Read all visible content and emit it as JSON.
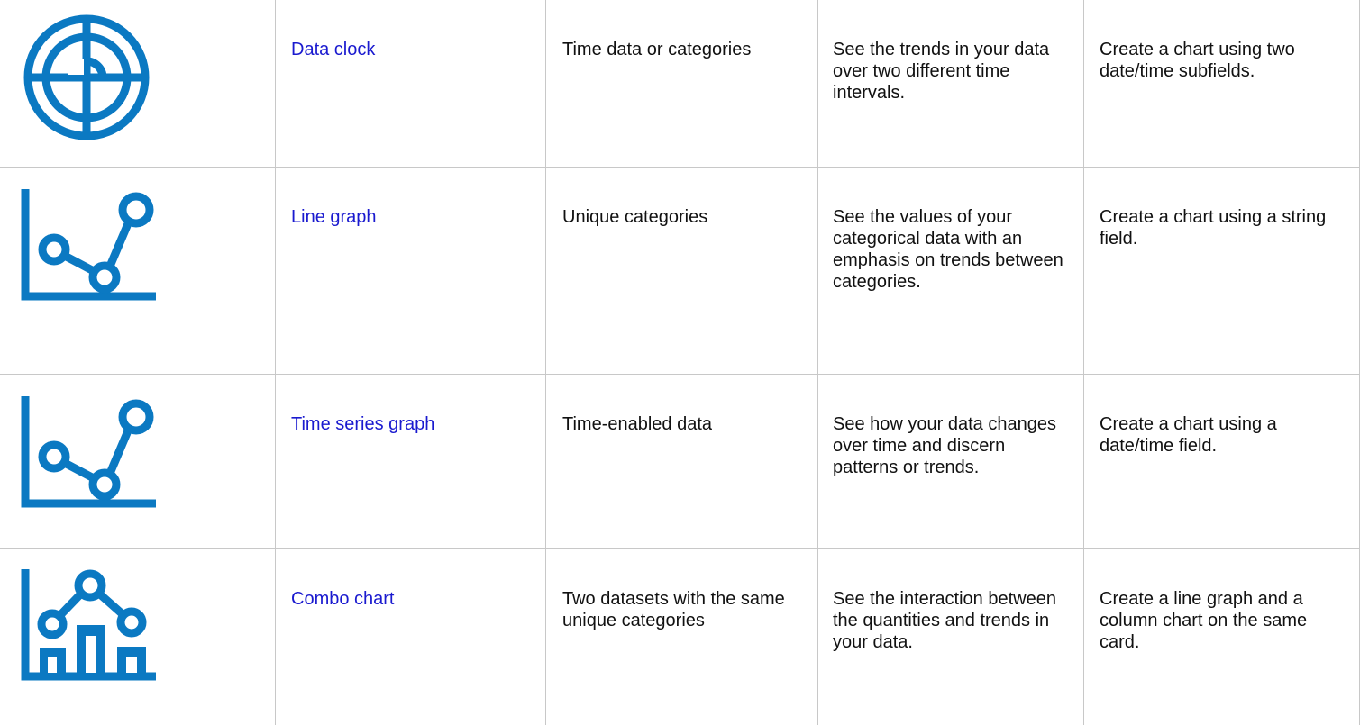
{
  "rows": [
    {
      "icon": "data-clock-icon",
      "name": "Data clock",
      "input": "Time data or categories",
      "purpose": "See the trends in your data over two different time intervals.",
      "create": "Create a chart using two date/time subfields."
    },
    {
      "icon": "line-graph-icon",
      "name": "Line graph",
      "input": "Unique categories",
      "purpose": "See the values of your categorical data with an emphasis on trends between categories.",
      "create": "Create a chart using a string field."
    },
    {
      "icon": "line-graph-icon",
      "name": "Time series graph",
      "input": "Time-enabled data",
      "purpose": "See how your data changes over time and discern patterns or trends.",
      "create": "Create a chart using a date/time field."
    },
    {
      "icon": "combo-chart-icon",
      "name": "Combo chart",
      "input": "Two datasets with the same unique categories",
      "purpose": "See the interaction between the quantities and trends in your data.",
      "create": "Create a line graph and a column chart on the same card."
    }
  ],
  "colors": {
    "icon": "#0b79c2",
    "link": "#1a1acf",
    "grid": "#c8c8c8",
    "text": "#111111"
  }
}
